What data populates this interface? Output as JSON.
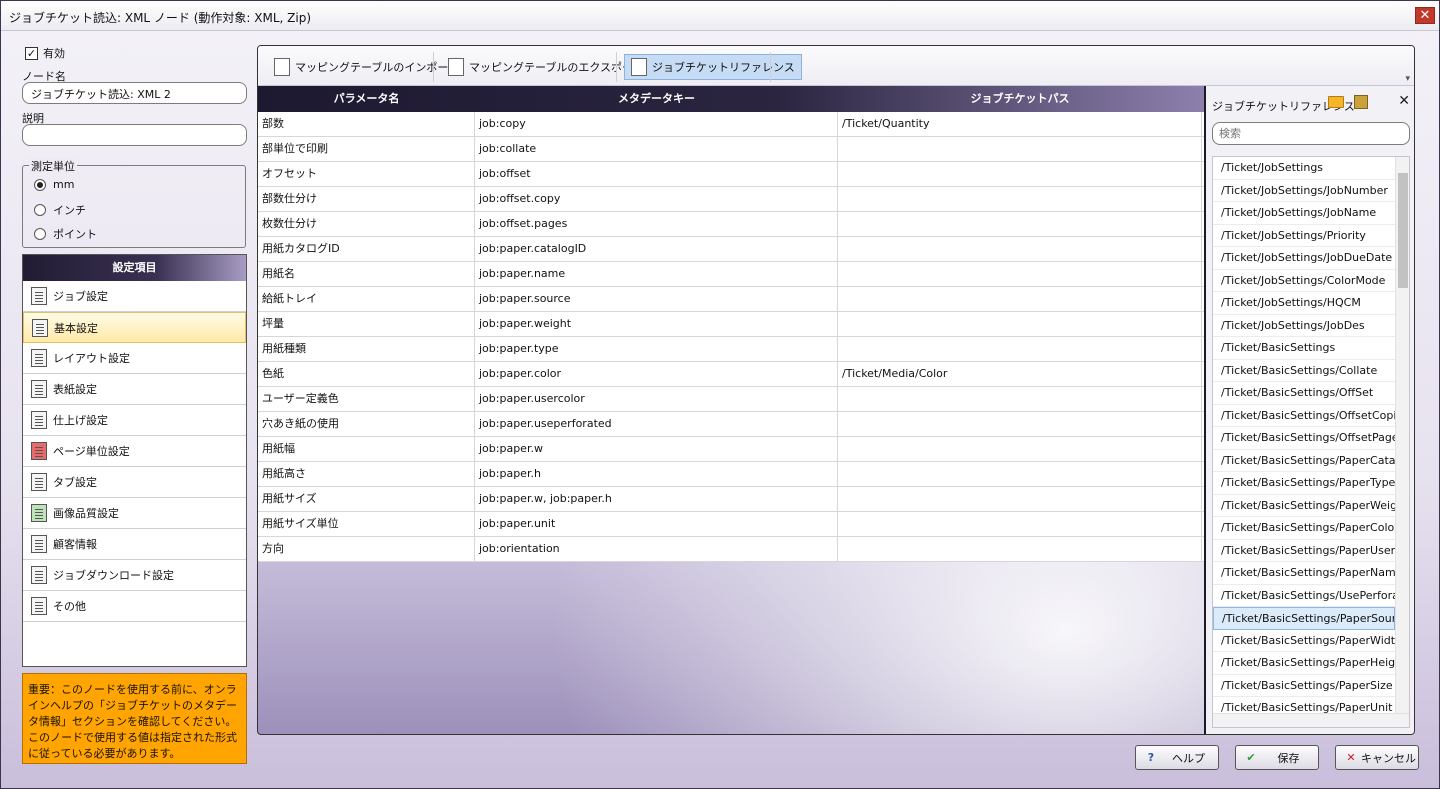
{
  "window": {
    "title": "ジョブチケット読込: XML ノード (動作対象: XML, Zip)",
    "close": "✕"
  },
  "left": {
    "enabled_label": "有効",
    "enabled_check": "✓",
    "node_name_label": "ノード名",
    "node_name_value": "ジョブチケット読込: XML 2",
    "description_label": "説明",
    "description_value": "",
    "unit_group_title": "測定単位",
    "units": [
      {
        "label": "mm",
        "selected": true
      },
      {
        "label": "インチ",
        "selected": false
      },
      {
        "label": "ポイント",
        "selected": false
      }
    ],
    "settings_title": "設定項目",
    "settings_items": [
      {
        "label": "ジョブ設定",
        "icon": "document-icon"
      },
      {
        "label": "基本設定",
        "icon": "list-icon"
      },
      {
        "label": "レイアウト設定",
        "icon": "layout-icon"
      },
      {
        "label": "表紙設定",
        "icon": "cover-icon"
      },
      {
        "label": "仕上げ設定",
        "icon": "finishing-icon"
      },
      {
        "label": "ページ単位設定",
        "icon": "pages-icon"
      },
      {
        "label": "タブ設定",
        "icon": "tab-icon"
      },
      {
        "label": "画像品質設定",
        "icon": "image-icon"
      },
      {
        "label": "顧客情報",
        "icon": "customer-icon"
      },
      {
        "label": "ジョブダウンロード設定",
        "icon": "download-icon"
      },
      {
        "label": "その他",
        "icon": "other-icon"
      }
    ],
    "notice_text": "重要：このノードを使用する前に、オンラインヘルプの「ジョブチケットのメタデータ情報」セクションを確認してください。このノードで使用する値は指定された形式に従っている必要があります。"
  },
  "toolbar": {
    "import_label": "マッピングテーブルのインポート",
    "export_label": "マッピングテーブルのエクスポート",
    "reference_label": "ジョブチケットリファレンス"
  },
  "grid": {
    "headers": [
      "パラメータ名",
      "メタデータキー",
      "ジョブチケットパス"
    ],
    "rows": [
      [
        "部数",
        "job:copy",
        "/Ticket/Quantity"
      ],
      [
        "部単位で印刷",
        "job:collate",
        ""
      ],
      [
        "オフセット",
        "job:offset",
        ""
      ],
      [
        "部数仕分け",
        "job:offset.copy",
        ""
      ],
      [
        "枚数仕分け",
        "job:offset.pages",
        ""
      ],
      [
        "用紙カタログID",
        "job:paper.catalogID",
        ""
      ],
      [
        "用紙名",
        "job:paper.name",
        ""
      ],
      [
        "給紙トレイ",
        "job:paper.source",
        ""
      ],
      [
        "坪量",
        "job:paper.weight",
        ""
      ],
      [
        "用紙種類",
        "job:paper.type",
        ""
      ],
      [
        "色紙",
        "job:paper.color",
        "/Ticket/Media/Color"
      ],
      [
        "ユーザー定義色",
        "job:paper.usercolor",
        ""
      ],
      [
        "穴あき紙の使用",
        "job:paper.useperforated",
        ""
      ],
      [
        "用紙幅",
        "job:paper.w",
        ""
      ],
      [
        "用紙高さ",
        "job:paper.h",
        ""
      ],
      [
        "用紙サイズ",
        "job:paper.w, job:paper.h",
        ""
      ],
      [
        "用紙サイズ単位",
        "job:paper.unit",
        ""
      ],
      [
        "方向",
        "job:orientation",
        ""
      ]
    ]
  },
  "reference": {
    "title": "ジョブチケットリファレンス",
    "close": "✕",
    "search_placeholder": "検索",
    "items": [
      "/Ticket/JobSettings",
      "/Ticket/JobSettings/JobNumber",
      "/Ticket/JobSettings/JobName",
      "/Ticket/JobSettings/Priority",
      "/Ticket/JobSettings/JobDueDate",
      "/Ticket/JobSettings/ColorMode",
      "/Ticket/JobSettings/HQCM",
      "/Ticket/JobSettings/JobDes",
      "/Ticket/BasicSettings",
      "/Ticket/BasicSettings/Collate",
      "/Ticket/BasicSettings/OffSet",
      "/Ticket/BasicSettings/OffsetCopies",
      "/Ticket/BasicSettings/OffsetPages",
      "/Ticket/BasicSettings/PaperCatalog",
      "/Ticket/BasicSettings/PaperType",
      "/Ticket/BasicSettings/PaperWeight",
      "/Ticket/BasicSettings/PaperColor",
      "/Ticket/BasicSettings/PaperUserColor",
      "/Ticket/BasicSettings/PaperName",
      "/Ticket/BasicSettings/UsePerforated",
      "/Ticket/BasicSettings/PaperSource",
      "/Ticket/BasicSettings/PaperWidth",
      "/Ticket/BasicSettings/PaperHeight",
      "/Ticket/BasicSettings/PaperSize",
      "/Ticket/BasicSettings/PaperUnit"
    ],
    "selected_index": 20
  },
  "buttons": {
    "help": "ヘルプ",
    "save": "保存",
    "cancel": "キャンセル"
  },
  "colors": {
    "accent_header": "#2b2540",
    "notice_bg": "#ffa400",
    "selection": "#dcebfa"
  }
}
